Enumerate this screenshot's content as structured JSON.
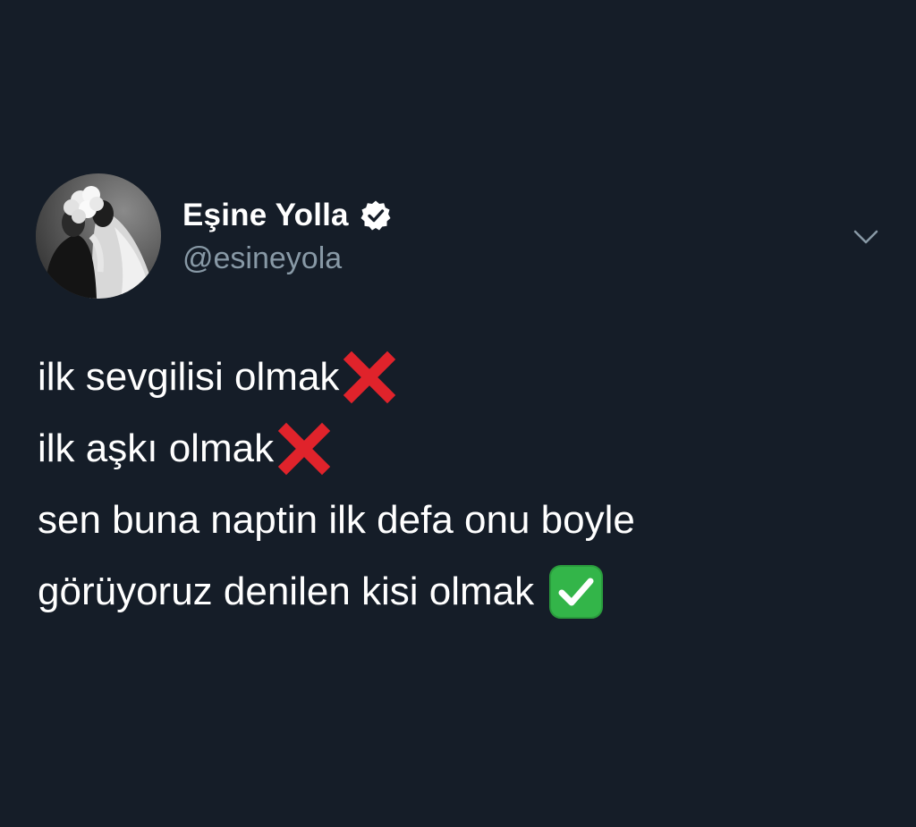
{
  "tweet": {
    "display_name": "Eşine Yolla",
    "handle": "@esineyola",
    "verified": true,
    "lines": [
      "ilk sevgilisi olmak",
      "ilk aşkı olmak",
      "sen buna naptin ilk defa onu boyle",
      "görüyoruz denilen kisi olmak"
    ]
  },
  "icons": {
    "avatar": "profile-photo-bride-groom",
    "verified": "verified-badge-icon",
    "caret": "chevron-down-icon",
    "cross": "cross-mark-emoji",
    "check": "check-mark-button-emoji"
  },
  "colors": {
    "background": "#151d28",
    "text": "#ffffff",
    "handle": "#8899a6",
    "cross": "#e0232b",
    "check": "#33b549"
  }
}
